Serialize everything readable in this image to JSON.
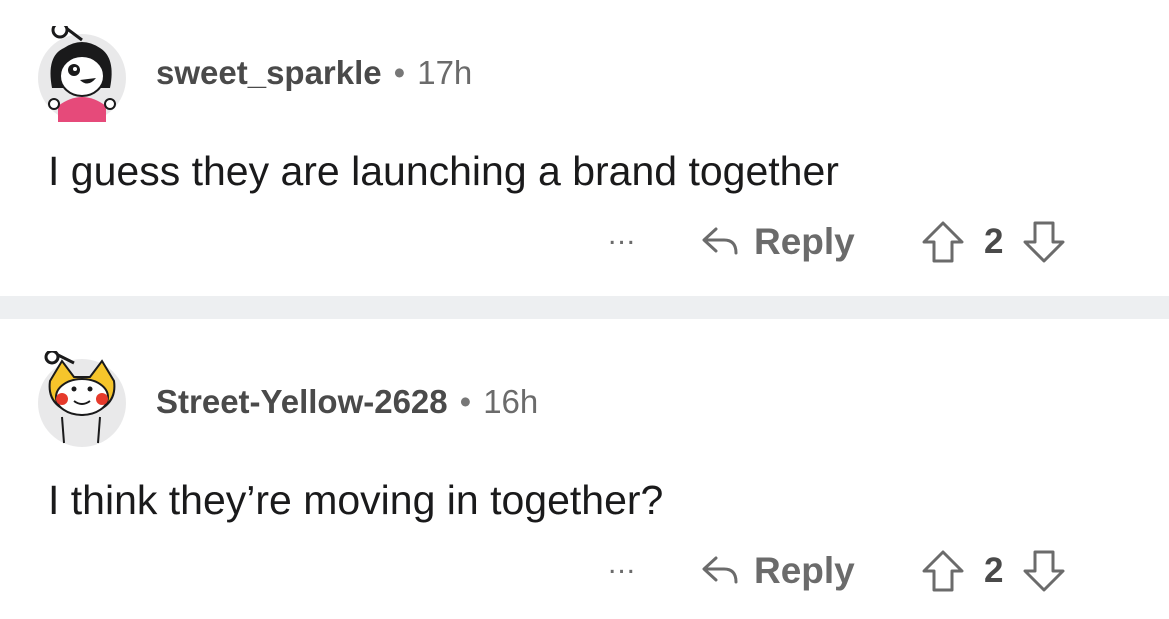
{
  "comments": [
    {
      "username": "sweet_sparkle",
      "separator": "•",
      "time": "17h",
      "text": "I guess they are launching a brand together",
      "more_label": "...",
      "reply_label": "Reply",
      "votes": "2"
    },
    {
      "username": "Street-Yellow-2628",
      "separator": "•",
      "time": "16h",
      "text": "I think they’re moving in together?",
      "more_label": "...",
      "reply_label": "Reply",
      "votes": "2"
    }
  ],
  "colors": {
    "divider": "#edeff1",
    "meta_text": "#6b6b6b",
    "body_text": "#1a1a1b"
  },
  "icons": [
    "avatar-icon",
    "reply-arrow-icon",
    "upvote-icon",
    "downvote-icon",
    "more-options-icon"
  ]
}
